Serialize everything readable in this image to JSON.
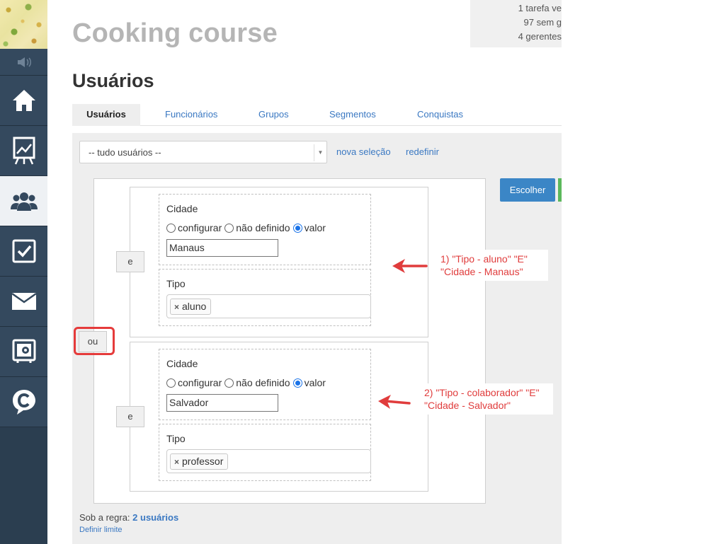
{
  "sidebar": {
    "items": [
      {
        "icon": "home-icon"
      },
      {
        "icon": "chart-board-icon"
      },
      {
        "icon": "users-icon",
        "active": true
      },
      {
        "icon": "checkbox-icon"
      },
      {
        "icon": "mail-icon"
      },
      {
        "icon": "safe-icon"
      },
      {
        "icon": "chat-c-icon"
      }
    ]
  },
  "header": {
    "course_title": "Cooking course",
    "notifications": [
      "1 tarefa ve",
      "97 sem g",
      "4 gerentes"
    ]
  },
  "page": {
    "title": "Usuários",
    "tabs": [
      "Usuários",
      "Funcionários",
      "Grupos",
      "Segmentos",
      "Conquistas"
    ]
  },
  "filter": {
    "select_value": "-- tudo usuários --",
    "new_selection": "nova seleção",
    "reset": "redefinir",
    "choose_button": "Escolher"
  },
  "rules": {
    "or_label": "ou",
    "and_label": "e",
    "groups": [
      {
        "city_label": "Cidade",
        "radio_options": [
          "configurar",
          "não definido",
          "valor"
        ],
        "selected_option": "valor",
        "city_value": "Manaus",
        "type_label": "Tipo",
        "type_tag": "aluno",
        "annotation_line1": "1) \"Tipo - aluno\" \"E\"",
        "annotation_line2": "\"Cidade - Manaus\""
      },
      {
        "city_label": "Cidade",
        "radio_options": [
          "configurar",
          "não definido",
          "valor"
        ],
        "selected_option": "valor",
        "city_value": "Salvador",
        "type_label": "Tipo",
        "type_tag": "professor",
        "annotation_line1": "2) \"Tipo - colaborador\" \"E\"",
        "annotation_line2": "\"Cidade - Salvador\""
      }
    ]
  },
  "footer": {
    "rule_prefix": "Sob a regra:",
    "rule_count": "2 usuários",
    "limit_link": "Definir limite"
  },
  "colors": {
    "sidebar": "#34495e",
    "link": "#3a78c2",
    "primary_button": "#3b86c6",
    "annotation": "#e03c3c"
  }
}
